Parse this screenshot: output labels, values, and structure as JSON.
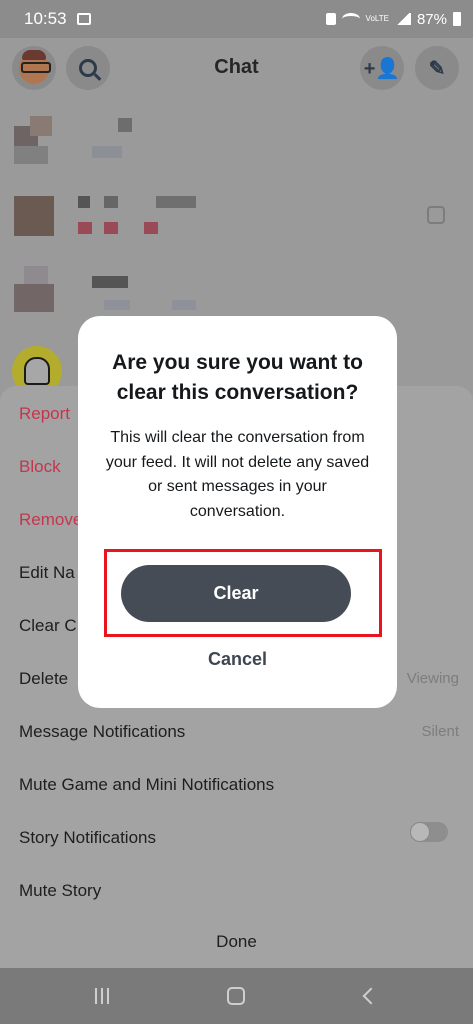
{
  "status_bar": {
    "time": "10:53",
    "volte": "VoLTE",
    "battery_percent": "87%",
    "icons": [
      "gallery-icon",
      "lock-icon",
      "wifi-icon",
      "volte-icon",
      "signal-icon",
      "battery-icon"
    ]
  },
  "header": {
    "title": "Chat",
    "icons": [
      "avatar",
      "search-icon",
      "add-friend-icon",
      "new-chat-icon"
    ]
  },
  "dialog": {
    "title": "Are you sure you want to clear this conversation?",
    "body": "This will clear the conversation from your feed. It will not delete any saved or sent messages in your conversation.",
    "clear_label": "Clear",
    "cancel_label": "Cancel",
    "highlight_color": "#e8151f"
  },
  "sheet": {
    "items": [
      {
        "label": "Report",
        "color": "red"
      },
      {
        "label": "Block",
        "color": "red"
      },
      {
        "label": "Remove",
        "color": "red"
      },
      {
        "label": "Edit Na",
        "color": "dark"
      },
      {
        "label": "Clear C",
        "color": "dark"
      },
      {
        "label": "Delete",
        "color": "dark"
      },
      {
        "label": "Message Notifications",
        "color": "dark"
      },
      {
        "label": "Mute Game and Mini Notifications",
        "color": "dark"
      },
      {
        "label": "Story Notifications",
        "color": "dark"
      },
      {
        "label": "Mute Story",
        "color": "dark"
      }
    ],
    "delete_value": "Viewing",
    "message_notifications_value": "Silent",
    "story_notifications_toggle": "off",
    "done_label": "Done"
  },
  "nav_bar": {
    "icons": [
      "recents-icon",
      "home-icon",
      "back-icon"
    ]
  },
  "colors": {
    "accent_red": "#c4364e",
    "dialog_button": "#454c56",
    "overlay": "#9a9a9a"
  }
}
